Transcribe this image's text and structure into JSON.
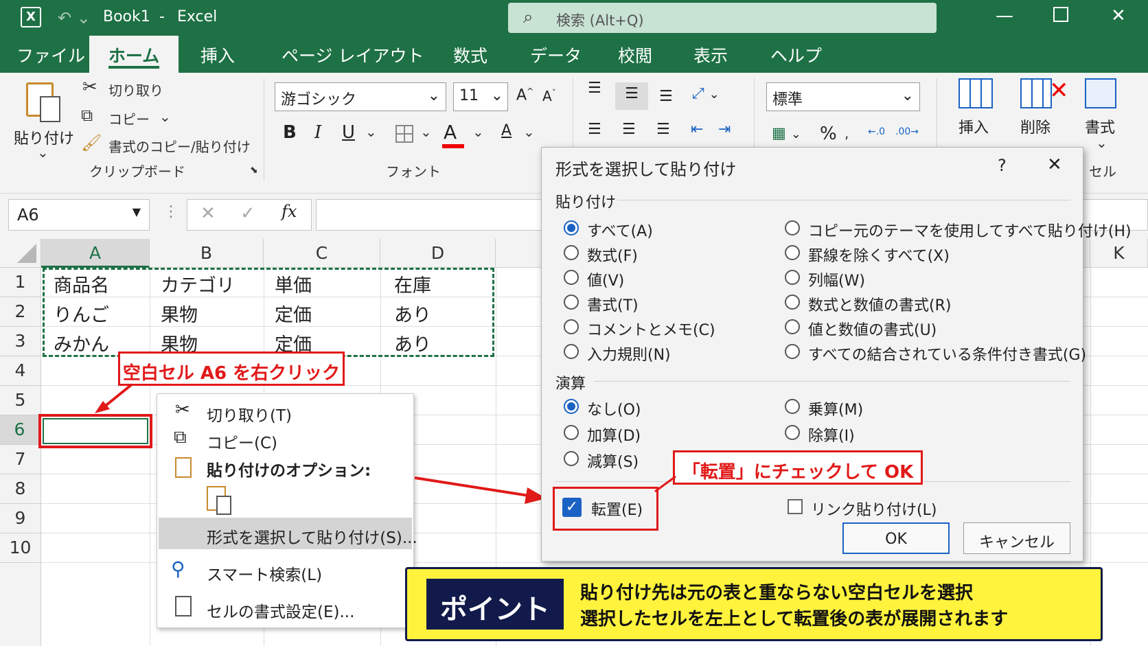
{
  "app": {
    "icon_label": "X",
    "doc_title": "Book1",
    "separator": "-",
    "app_name": "Excel"
  },
  "search": {
    "placeholder": "検索 (Alt+Q)"
  },
  "tabs": [
    "ファイル",
    "ホーム",
    "挿入",
    "ページ レイアウト",
    "数式",
    "データ",
    "校閲",
    "表示",
    "ヘルプ"
  ],
  "ribbon": {
    "paste": "貼り付け",
    "cut": "切り取り",
    "copy": "コピー",
    "format_painter": "書式のコピー/貼り付け",
    "clipboard_group": "クリップボード",
    "font_name": "游ゴシック",
    "font_size": "11",
    "font_group": "フォント",
    "bold": "B",
    "italic": "I",
    "underline": "U",
    "number_format": "標準",
    "insert": "挿入",
    "delete": "削除",
    "format": "書式",
    "cells_group": "セル"
  },
  "formula_bar": {
    "name_box": "A6",
    "fx": "fx"
  },
  "columns": [
    "A",
    "B",
    "C",
    "D",
    "K"
  ],
  "rows": [
    "1",
    "2",
    "3",
    "4",
    "5",
    "6",
    "7",
    "8",
    "9",
    "10"
  ],
  "cells": [
    [
      "商品名",
      "カテゴリ",
      "単価",
      "在庫"
    ],
    [
      "りんご",
      "果物",
      "定価",
      "あり"
    ],
    [
      "みかん",
      "果物",
      "定価",
      "あり"
    ]
  ],
  "callouts": {
    "right_click": "空白セル A6 を右クリック",
    "transpose": "「転置」にチェックして OK"
  },
  "context_menu": {
    "cut": "切り取り(T)",
    "copy": "コピー(C)",
    "paste_options": "貼り付けのオプション:",
    "paste_special": "形式を選択して貼り付け(S)...",
    "smart_lookup": "スマート検索(L)",
    "format_cells": "セルの書式設定(E)..."
  },
  "dialog": {
    "title": "形式を選択して貼り付け",
    "help": "?",
    "close": "✕",
    "paste_label": "貼り付け",
    "paste_left": [
      "すべて(A)",
      "数式(F)",
      "値(V)",
      "書式(T)",
      "コメントとメモ(C)",
      "入力規則(N)"
    ],
    "paste_right": [
      "コピー元のテーマを使用してすべて貼り付け(H)",
      "罫線を除くすべて(X)",
      "列幅(W)",
      "数式と数値の書式(R)",
      "値と数値の書式(U)",
      "すべての結合されている条件付き書式(G)"
    ],
    "operation_label": "演算",
    "op_left": [
      "なし(O)",
      "加算(D)",
      "減算(S)"
    ],
    "op_right": [
      "乗算(M)",
      "除算(I)"
    ],
    "transpose": "転置(E)",
    "paste_link": "リンク貼り付け(L)",
    "ok": "OK",
    "cancel": "キャンセル"
  },
  "point": {
    "badge": "ポイント",
    "line1": "貼り付け先は元の表と重ならない空白セルを選択",
    "line2": "選択したセルを左上として転置後の表が展開されます"
  },
  "colors": {
    "excel_green": "#1e7145",
    "callout_red": "#e11919",
    "point_yellow": "#fff33d",
    "point_navy": "#111a4a",
    "radio_blue": "#1a62c4"
  }
}
